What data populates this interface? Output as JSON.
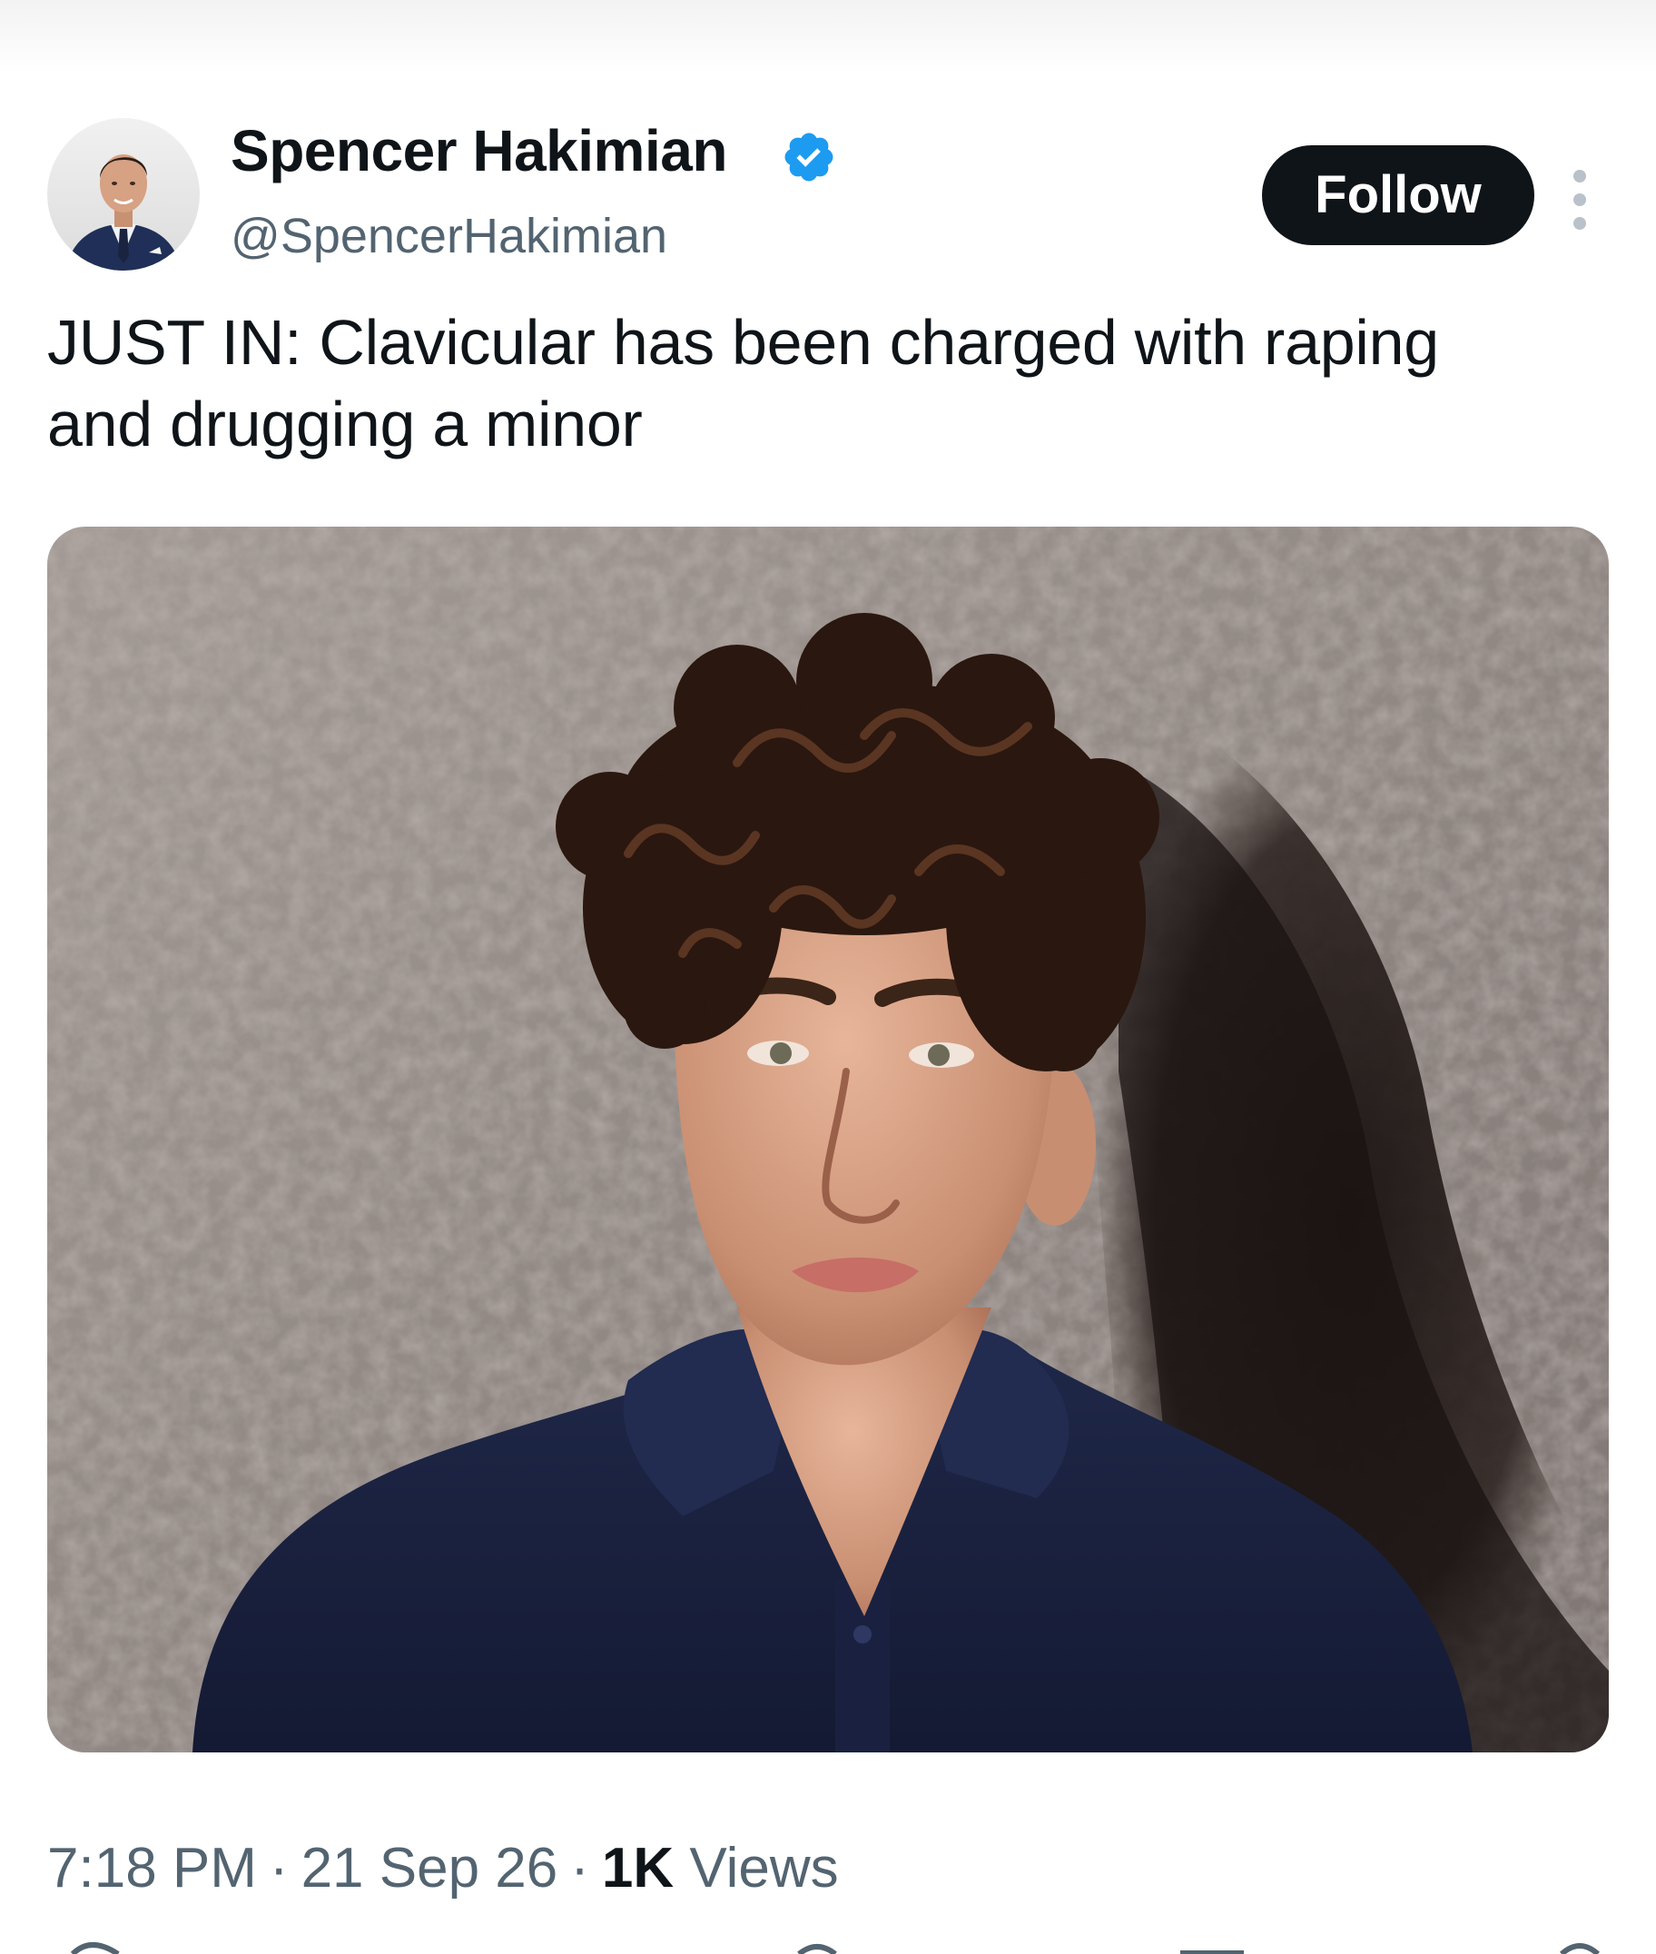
{
  "author": {
    "display_name": "Spencer Hakimian",
    "handle": "@SpencerHakimian",
    "verified": true,
    "avatar_icon": "profile-photo-man-in-suit"
  },
  "actions": {
    "follow_label": "Follow",
    "more_icon": "vertical-ellipsis-icon"
  },
  "tweet": {
    "text_line1": "JUST IN: Clavicular has been charged with raping",
    "text_line2": "and drugging a minor"
  },
  "media": {
    "kind": "photo",
    "subject": "portrait of young man with curly hair in navy polo shirt against textured wall"
  },
  "meta": {
    "time": "7:18 PM",
    "date": "21 Sep 26",
    "views_count": "1K",
    "views_label": "Views",
    "separator": "·"
  },
  "colors": {
    "text_primary": "#0f1419",
    "text_secondary": "#536471",
    "verified_blue": "#1d9bf0",
    "follow_bg": "#0f1419"
  }
}
